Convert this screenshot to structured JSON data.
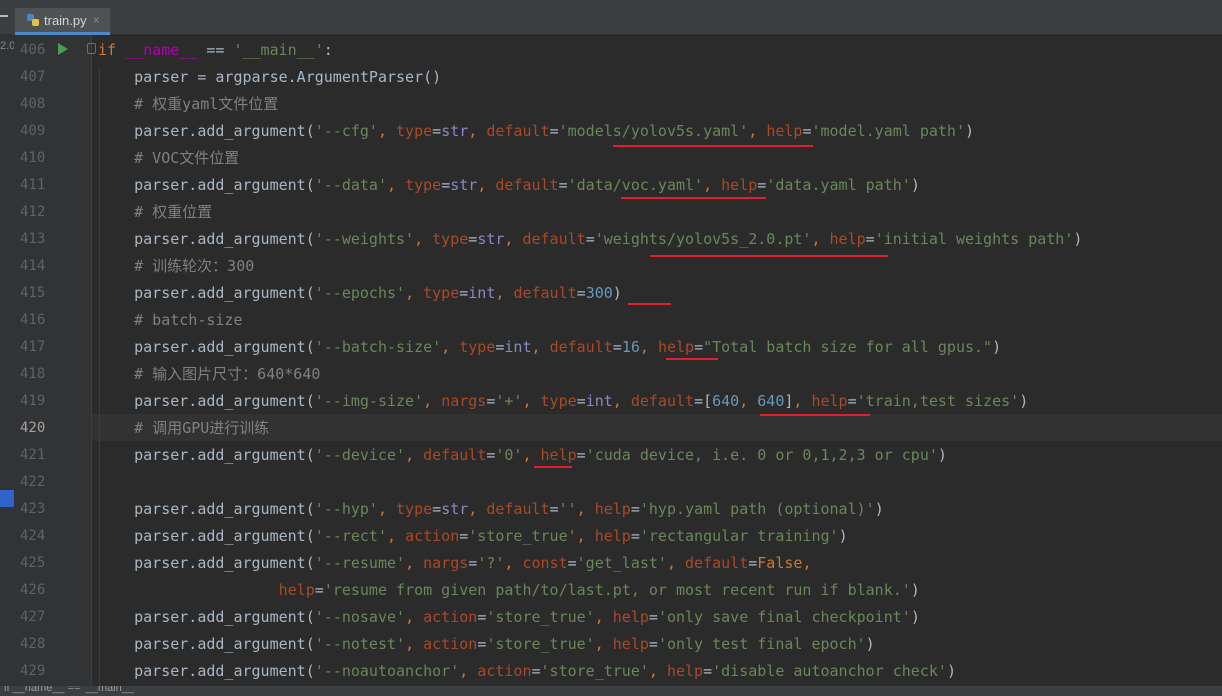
{
  "tab": {
    "filename": "train.py",
    "close": "×"
  },
  "side_version": "2.0",
  "breadcrumb": "if __name__ == '__main__'",
  "gutter": {
    "current_line": 420,
    "line_numbers": [
      "406",
      "407",
      "408",
      "409",
      "410",
      "411",
      "412",
      "413",
      "414",
      "415",
      "416",
      "417",
      "418",
      "419",
      "420",
      "421",
      "422",
      "423",
      "424",
      "425",
      "426",
      "427",
      "428",
      "429"
    ]
  },
  "code": {
    "l406": {
      "if": "if",
      "dunder": "__name__",
      "eq": " == ",
      "main": "'__main__'",
      "colon": ":"
    },
    "l407": {
      "a": "parser = argparse.ArgumentParser()"
    },
    "l408": {
      "comment": "# 权重yaml文件位置"
    },
    "l409": {
      "head": "parser.add_argument(",
      "arg": "'--cfg'",
      "sep1": ", ",
      "k1": "type",
      "eq1": "=",
      "v1": "str",
      "sep2": ", ",
      "k2": "default",
      "eq2": "=",
      "v2": "'models/yolov5s.yaml'",
      "sep3": ", ",
      "k3": "help",
      "eq3": "=",
      "v3": "'model.yaml path'",
      "close": ")"
    },
    "l410": {
      "comment": "# VOC文件位置"
    },
    "l411": {
      "head": "parser.add_argument(",
      "arg": "'--data'",
      "sep1": ", ",
      "k1": "type",
      "eq1": "=",
      "v1": "str",
      "sep2": ", ",
      "k2": "default",
      "eq2": "=",
      "v2": "'data/voc.yaml'",
      "sep3": ", ",
      "k3": "help",
      "eq3": "=",
      "v3": "'data.yaml path'",
      "close": ")"
    },
    "l412": {
      "comment": "# 权重位置"
    },
    "l413": {
      "head": "parser.add_argument(",
      "arg": "'--weights'",
      "sep1": ", ",
      "k1": "type",
      "eq1": "=",
      "v1": "str",
      "sep2": ", ",
      "k2": "default",
      "eq2": "=",
      "v2": "'weights/yolov5s_2.0.pt'",
      "sep3": ", ",
      "k3": "help",
      "eq3": "=",
      "v3": "'initial weights path'",
      "close": ")"
    },
    "l414": {
      "comment": "# 训练轮次：300"
    },
    "l415": {
      "head": "parser.add_argument(",
      "arg": "'--epochs'",
      "sep1": ", ",
      "k1": "type",
      "eq1": "=",
      "v1": "int",
      "sep2": ", ",
      "k2": "default",
      "eq2": "=",
      "v2": "300",
      "close": ")"
    },
    "l416": {
      "comment": "# batch-size"
    },
    "l417": {
      "head": "parser.add_argument(",
      "arg": "'--batch-size'",
      "sep1": ", ",
      "k1": "type",
      "eq1": "=",
      "v1": "int",
      "sep2": ", ",
      "k2": "default",
      "eq2": "=",
      "v2": "16",
      "sep3": ", ",
      "k3": "help",
      "eq3": "=",
      "v3": "\"Total batch size for all gpus.\"",
      "close": ")"
    },
    "l418": {
      "comment": "# 输入图片尺寸：640*640"
    },
    "l419": {
      "head": "parser.add_argument(",
      "arg": "'--img-size'",
      "sep1": ", ",
      "k1": "nargs",
      "eq1": "=",
      "v1": "'+'",
      "sep2": ", ",
      "k2": "type",
      "eq2": "=",
      "v2": "int",
      "sep3": ", ",
      "k3": "default",
      "eq3": "=",
      "ob": "[",
      "n1": "640",
      "cm": ", ",
      "n2": "640",
      "cb": "]",
      "sep4": ", ",
      "k4": "help",
      "eq4": "=",
      "v4": "'train,test sizes'",
      "close": ")"
    },
    "l420": {
      "comment": "# 调用GPU进行训练"
    },
    "l421": {
      "head": "parser.add_argument(",
      "arg": "'--device'",
      "sep1": ", ",
      "k1": "default",
      "eq1": "=",
      "v1": "'0'",
      "sep2": ", ",
      "k2": "help",
      "eq2": "=",
      "v2": "'cuda device, i.e. 0 or 0,1,2,3 or cpu'",
      "close": ")"
    },
    "l423": {
      "head": "parser.add_argument(",
      "arg": "'--hyp'",
      "sep1": ", ",
      "k1": "type",
      "eq1": "=",
      "v1": "str",
      "sep2": ", ",
      "k2": "default",
      "eq2": "=",
      "v2": "''",
      "sep3": ", ",
      "k3": "help",
      "eq3": "=",
      "v3": "'hyp.yaml path (optional)'",
      "close": ")"
    },
    "l424": {
      "head": "parser.add_argument(",
      "arg": "'--rect'",
      "sep1": ", ",
      "k1": "action",
      "eq1": "=",
      "v1": "'store_true'",
      "sep2": ", ",
      "k2": "help",
      "eq2": "=",
      "v2": "'rectangular training'",
      "close": ")"
    },
    "l425": {
      "head": "parser.add_argument(",
      "arg": "'--resume'",
      "sep1": ", ",
      "k1": "nargs",
      "eq1": "=",
      "v1": "'?'",
      "sep2": ", ",
      "k2": "const",
      "eq2": "=",
      "v2": "'get_last'",
      "sep3": ", ",
      "k3": "default",
      "eq3": "=",
      "v3": "False",
      "tail": ","
    },
    "l426": {
      "k1": "help",
      "eq1": "=",
      "v1": "'resume from given path/to/last.pt, or most recent run if blank.'",
      "close": ")"
    },
    "l427": {
      "head": "parser.add_argument(",
      "arg": "'--nosave'",
      "sep1": ", ",
      "k1": "action",
      "eq1": "=",
      "v1": "'store_true'",
      "sep2": ", ",
      "k2": "help",
      "eq2": "=",
      "v2": "'only save final checkpoint'",
      "close": ")"
    },
    "l428": {
      "head": "parser.add_argument(",
      "arg": "'--notest'",
      "sep1": ", ",
      "k1": "action",
      "eq1": "=",
      "v1": "'store_true'",
      "sep2": ", ",
      "k2": "help",
      "eq2": "=",
      "v2": "'only test final epoch'",
      "close": ")"
    },
    "l429": {
      "head": "parser.add_argument(",
      "arg": "'--noautoanchor'",
      "sep1": ", ",
      "k1": "action",
      "eq1": "=",
      "v1": "'store_true'",
      "sep2": ", ",
      "k2": "help",
      "eq2": "=",
      "v2": "'disable autoanchor check'",
      "close": ")"
    }
  },
  "colors": {
    "background": "#2b2b2b",
    "keyword": "#cc7832",
    "string": "#6a8759",
    "number": "#6897bb",
    "comment": "#808080",
    "param": "#aa4926",
    "dunder": "#b200b2",
    "annotation_underline": "#e02030"
  }
}
